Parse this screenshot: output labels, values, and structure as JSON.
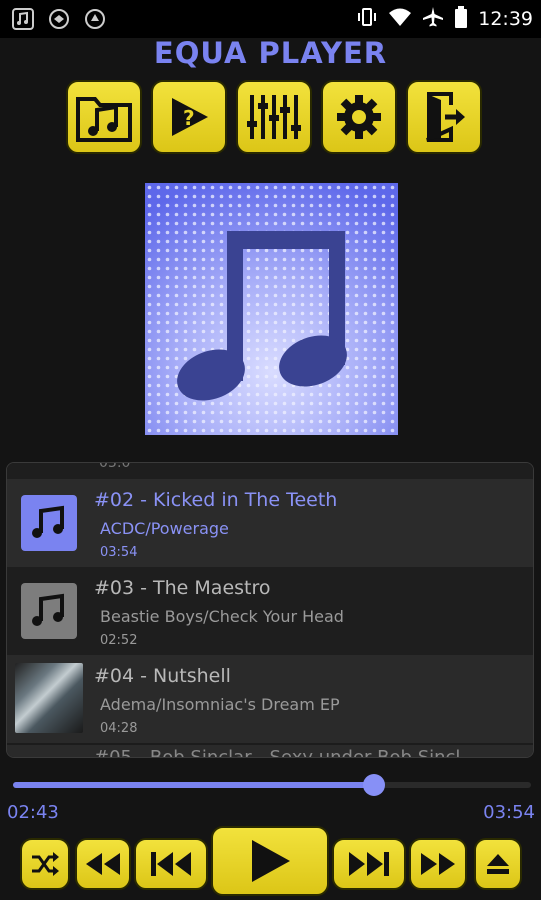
{
  "status_bar": {
    "time": "12:39",
    "icons": [
      "music-note-icon",
      "app-icon",
      "app-icon-2",
      "vibrate-icon",
      "wifi-icon",
      "airplane-icon",
      "battery-icon"
    ]
  },
  "app": {
    "title": "EQUA PLAYER",
    "accent_color": "#7a83f0",
    "button_color": "#e8d62a"
  },
  "toolbar": {
    "buttons": [
      "folder-music-icon",
      "play-help-icon",
      "equalizer-icon",
      "settings-gear-icon",
      "exit-icon"
    ]
  },
  "album_art": {
    "icon": "music-note-icon"
  },
  "playlist": {
    "peek_top_text": "03:0",
    "tracks": [
      {
        "title": "#02 - Kicked in The Teeth",
        "artist": "ACDC/Powerage",
        "duration": "03:54",
        "active": true
      },
      {
        "title": "#03 - The Maestro",
        "artist": "Beastie Boys/Check Your Head",
        "duration": "02:52",
        "active": false
      },
      {
        "title": "#04 - Nutshell",
        "artist": "Adema/Insomniac's Dream EP",
        "duration": "04:28",
        "active": false
      }
    ],
    "peek_bottom_text": "#05 - Bob Sinclar - Sexy under Bob Sincl"
  },
  "progress": {
    "elapsed": "02:43",
    "total": "03:54",
    "fraction": 0.696
  },
  "transport": {
    "buttons": [
      "shuffle-icon",
      "fast-rewind-icon",
      "skip-previous-icon",
      "play-icon",
      "skip-next-icon",
      "fast-forward-icon",
      "eject-icon"
    ]
  }
}
